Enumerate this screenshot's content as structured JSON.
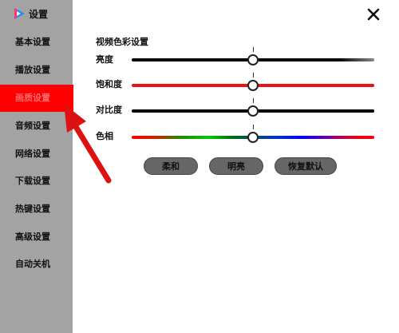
{
  "window": {
    "title": "设置",
    "close_icon": "close-icon",
    "logo_icon": "play-logo-icon"
  },
  "sidebar": {
    "items": [
      {
        "label": "基本设置",
        "active": false
      },
      {
        "label": "播放设置",
        "active": false
      },
      {
        "label": "画质设置",
        "active": true
      },
      {
        "label": "音频设置",
        "active": false
      },
      {
        "label": "网络设置",
        "active": false
      },
      {
        "label": "下载设置",
        "active": false
      },
      {
        "label": "热键设置",
        "active": false
      },
      {
        "label": "高级设置",
        "active": false
      },
      {
        "label": "自动关机",
        "active": false
      }
    ]
  },
  "main": {
    "section_title": "视频色彩设置",
    "sliders": [
      {
        "label": "亮度",
        "value": 0.5,
        "color": "#000000"
      },
      {
        "label": "饱和度",
        "value": 0.5,
        "color": "#ee1111"
      },
      {
        "label": "对比度",
        "value": 0.5,
        "color": "#000000"
      },
      {
        "label": "色相",
        "value": 0.5,
        "color": "gradient"
      }
    ],
    "buttons": [
      {
        "label": "柔和"
      },
      {
        "label": "明亮"
      },
      {
        "label": "恢复默认"
      }
    ]
  },
  "colors": {
    "sidebar_bg": "#a3a3a3",
    "accent": "#ff0000",
    "button_bg": "#666666"
  }
}
